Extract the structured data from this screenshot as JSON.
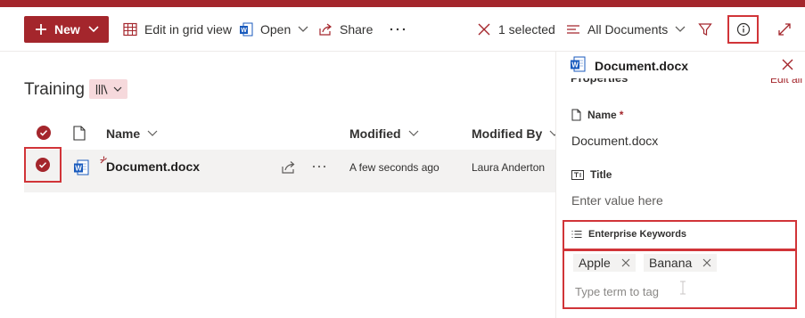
{
  "command_bar": {
    "new_label": "New",
    "edit_grid_label": "Edit in grid view",
    "open_label": "Open",
    "share_label": "Share",
    "selected_label": "1 selected",
    "view_label": "All Documents"
  },
  "library": {
    "title": "Training"
  },
  "columns": {
    "name": "Name",
    "modified": "Modified",
    "modified_by": "Modified By"
  },
  "rows": [
    {
      "name": "Document.docx",
      "modified": "A few seconds ago",
      "modified_by": "Laura Anderton",
      "selected": true
    }
  ],
  "details_panel": {
    "file_name": "Document.docx",
    "section_heading": "Properties",
    "edit_all_label": "Edit all",
    "name_label": "Name",
    "required_marker": "*",
    "name_value": "Document.docx",
    "title_label": "Title",
    "title_placeholder": "Enter value here",
    "keywords_label": "Enterprise Keywords",
    "keywords": [
      "Apple",
      "Banana"
    ],
    "keywords_placeholder": "Type term to tag"
  },
  "colors": {
    "accent": "#a4262c",
    "highlight_border": "#d13438",
    "selected_row": "#f3f2f1",
    "word_blue": "#185abd"
  }
}
